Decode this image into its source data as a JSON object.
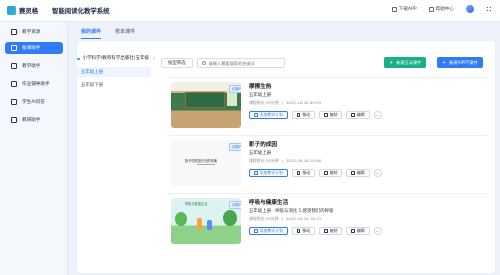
{
  "header": {
    "brand": "赛灵格",
    "subtitle": "智能阅读化教学系统",
    "actions": [
      {
        "label": "下载APP",
        "icon": "download-icon"
      },
      {
        "label": "帮助中心",
        "icon": "help-icon"
      },
      {
        "label": "",
        "icon": "avatar"
      },
      {
        "label": "",
        "icon": "grid-icon"
      }
    ]
  },
  "sidebar": {
    "items": [
      {
        "label": "教学资源",
        "icon": "book-icon"
      },
      {
        "label": "备课助手",
        "icon": "prep-icon",
        "active": true
      },
      {
        "label": "教学助手",
        "icon": "teach-icon"
      },
      {
        "label": "作业辅导助手",
        "icon": "homework-icon"
      },
      {
        "label": "学生AI问答",
        "icon": "qa-icon"
      },
      {
        "label": "教研助手",
        "icon": "research-icon"
      }
    ]
  },
  "tabs": [
    {
      "label": "我的课件",
      "active": true
    },
    {
      "label": "校本课件",
      "active": false
    }
  ],
  "tree": {
    "root": "小学科学(教育科学出版社)五年级",
    "children": [
      {
        "label": "五年级上册",
        "active": true
      },
      {
        "label": "五年级下册",
        "active": false
      }
    ]
  },
  "toolbar": {
    "filter_label": "按型筛选",
    "search_placeholder": "请输入需要搜索的关键词",
    "new_html_label": "新建互动课件",
    "new_ppt_label": "新建AIPPT课件"
  },
  "cards": [
    {
      "title": "摩擦生热",
      "badge": "创新PPT",
      "grade": "五年级上册",
      "duration": "课程时长:35分钟",
      "date": "2025-10-20 09:59",
      "actions": {
        "plan": "添加教学计划",
        "move": "移动",
        "copy": "复制",
        "edit": "编辑"
      }
    },
    {
      "title": "影子的成因",
      "badge": "创新PPT",
      "grade": "五年级上册",
      "duration": "课程时长:35分钟",
      "date": "2025-09-18 14:46",
      "thumb_text": "影子的成因与光的传播",
      "actions": {
        "plan": "添加教学计划",
        "move": "移动",
        "copy": "复制",
        "edit": "编辑"
      }
    },
    {
      "title": "呼吸与健康生活",
      "badge": "创新PPT",
      "grade": "五年级上册 · 呼吸与消化 1.感受我们的呼吸",
      "duration": "课程时长:35分钟",
      "date": "2025-10-10 16:13",
      "thumb_text": "呼吸与健康生活",
      "actions": {
        "plan": "添加教学计划",
        "move": "移动",
        "copy": "复制",
        "edit": "编辑"
      }
    }
  ],
  "colors": {
    "primary": "#2f7cf6",
    "green": "#1cae86",
    "sidebar_bg": "#f4f7fc",
    "page_bg": "#eef3fb"
  }
}
